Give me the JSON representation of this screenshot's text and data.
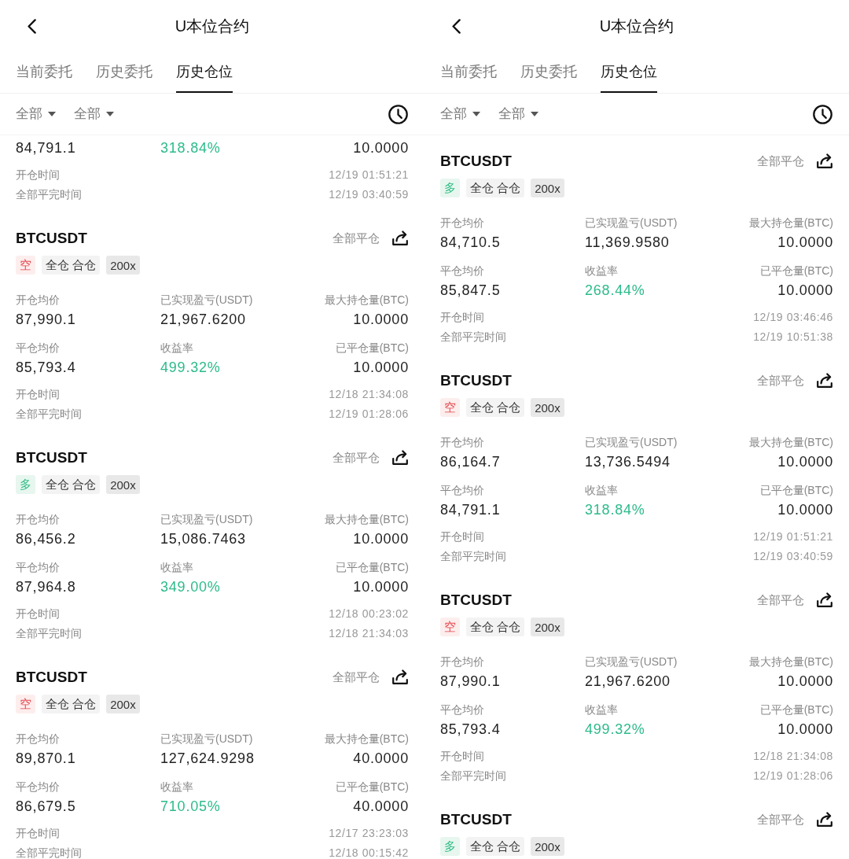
{
  "screens": [
    {
      "title": "U本位合约",
      "tabs": [
        {
          "label": "当前委托",
          "selected": false
        },
        {
          "label": "历史委托",
          "selected": false
        },
        {
          "label": "历史仓位",
          "selected": true
        }
      ],
      "filters": [
        {
          "label": "全部"
        },
        {
          "label": "全部"
        }
      ],
      "positions": [
        {
          "metrics": [
            {
              "kind": "plain",
              "value": "84,791.1"
            },
            {
              "kind": "gain",
              "value": "318.84%"
            },
            {
              "kind": "plain",
              "value": "10.0000"
            }
          ],
          "times": [
            {
              "label": "开仓时间",
              "value": "12/19 01:51:21"
            },
            {
              "label": "全部平完时间",
              "value": "12/19 03:40:59"
            }
          ]
        },
        {
          "symbol": "BTCUSDT",
          "close_label": "全部平仓",
          "tags": [
            {
              "kind": "short",
              "text": "空"
            },
            {
              "kind": "mode",
              "text": "全仓 合仓"
            },
            {
              "kind": "leverage",
              "text": "200x"
            }
          ],
          "metrics": [
            {
              "kind": "plain",
              "label": "开仓均价",
              "value": "87,990.1"
            },
            {
              "kind": "plain",
              "label": "已实现盈亏(USDT)",
              "value": "21,967.6200"
            },
            {
              "kind": "plain",
              "label": "最大持仓量(BTC)",
              "value": "10.0000"
            },
            {
              "kind": "plain",
              "label": "平仓均价",
              "value": "85,793.4"
            },
            {
              "kind": "gain",
              "label": "收益率",
              "value": "499.32%"
            },
            {
              "kind": "plain",
              "label": "已平仓量(BTC)",
              "value": "10.0000"
            }
          ],
          "times": [
            {
              "label": "开仓时间",
              "value": "12/18 21:34:08"
            },
            {
              "label": "全部平完时间",
              "value": "12/19 01:28:06"
            }
          ]
        },
        {
          "symbol": "BTCUSDT",
          "close_label": "全部平仓",
          "tags": [
            {
              "kind": "long",
              "text": "多"
            },
            {
              "kind": "mode",
              "text": "全仓 合仓"
            },
            {
              "kind": "leverage",
              "text": "200x"
            }
          ],
          "metrics": [
            {
              "kind": "plain",
              "label": "开仓均价",
              "value": "86,456.2"
            },
            {
              "kind": "plain",
              "label": "已实现盈亏(USDT)",
              "value": "15,086.7463"
            },
            {
              "kind": "plain",
              "label": "最大持仓量(BTC)",
              "value": "10.0000"
            },
            {
              "kind": "plain",
              "label": "平仓均价",
              "value": "87,964.8"
            },
            {
              "kind": "gain",
              "label": "收益率",
              "value": "349.00%"
            },
            {
              "kind": "plain",
              "label": "已平仓量(BTC)",
              "value": "10.0000"
            }
          ],
          "times": [
            {
              "label": "开仓时间",
              "value": "12/18 00:23:02"
            },
            {
              "label": "全部平完时间",
              "value": "12/18 21:34:03"
            }
          ]
        },
        {
          "symbol": "BTCUSDT",
          "close_label": "全部平仓",
          "tags": [
            {
              "kind": "short",
              "text": "空"
            },
            {
              "kind": "mode",
              "text": "全仓 合仓"
            },
            {
              "kind": "leverage",
              "text": "200x"
            }
          ],
          "metrics": [
            {
              "kind": "plain",
              "label": "开仓均价",
              "value": "89,870.1"
            },
            {
              "kind": "plain",
              "label": "已实现盈亏(USDT)",
              "value": "127,624.9298"
            },
            {
              "kind": "plain",
              "label": "最大持仓量(BTC)",
              "value": "40.0000"
            },
            {
              "kind": "plain",
              "label": "平仓均价",
              "value": "86,679.5"
            },
            {
              "kind": "gain",
              "label": "收益率",
              "value": "710.05%"
            },
            {
              "kind": "plain",
              "label": "已平仓量(BTC)",
              "value": "40.0000"
            }
          ],
          "times": [
            {
              "label": "开仓时间",
              "value": "12/17 23:23:03"
            },
            {
              "label": "全部平完时间",
              "value": "12/18 00:15:42"
            }
          ]
        }
      ]
    },
    {
      "title": "U本位合约",
      "tabs": [
        {
          "label": "当前委托",
          "selected": false
        },
        {
          "label": "历史委托",
          "selected": false
        },
        {
          "label": "历史仓位",
          "selected": true
        }
      ],
      "filters": [
        {
          "label": "全部"
        },
        {
          "label": "全部"
        }
      ],
      "positions": [
        {
          "symbol": "BTCUSDT",
          "close_label": "全部平仓",
          "tags": [
            {
              "kind": "long",
              "text": "多"
            },
            {
              "kind": "mode",
              "text": "全仓 合仓"
            },
            {
              "kind": "leverage",
              "text": "200x"
            }
          ],
          "metrics": [
            {
              "kind": "plain",
              "label": "开仓均价",
              "value": "84,710.5"
            },
            {
              "kind": "plain",
              "label": "已实现盈亏(USDT)",
              "value": "11,369.9580"
            },
            {
              "kind": "plain",
              "label": "最大持仓量(BTC)",
              "value": "10.0000"
            },
            {
              "kind": "plain",
              "label": "平仓均价",
              "value": "85,847.5"
            },
            {
              "kind": "gain",
              "label": "收益率",
              "value": "268.44%"
            },
            {
              "kind": "plain",
              "label": "已平仓量(BTC)",
              "value": "10.0000"
            }
          ],
          "times": [
            {
              "label": "开仓时间",
              "value": "12/19 03:46:46"
            },
            {
              "label": "全部平完时间",
              "value": "12/19 10:51:38"
            }
          ]
        },
        {
          "symbol": "BTCUSDT",
          "close_label": "全部平仓",
          "tags": [
            {
              "kind": "short",
              "text": "空"
            },
            {
              "kind": "mode",
              "text": "全仓 合仓"
            },
            {
              "kind": "leverage",
              "text": "200x"
            }
          ],
          "metrics": [
            {
              "kind": "plain",
              "label": "开仓均价",
              "value": "86,164.7"
            },
            {
              "kind": "plain",
              "label": "已实现盈亏(USDT)",
              "value": "13,736.5494"
            },
            {
              "kind": "plain",
              "label": "最大持仓量(BTC)",
              "value": "10.0000"
            },
            {
              "kind": "plain",
              "label": "平仓均价",
              "value": "84,791.1"
            },
            {
              "kind": "gain",
              "label": "收益率",
              "value": "318.84%"
            },
            {
              "kind": "plain",
              "label": "已平仓量(BTC)",
              "value": "10.0000"
            }
          ],
          "times": [
            {
              "label": "开仓时间",
              "value": "12/19 01:51:21"
            },
            {
              "label": "全部平完时间",
              "value": "12/19 03:40:59"
            }
          ]
        },
        {
          "symbol": "BTCUSDT",
          "close_label": "全部平仓",
          "tags": [
            {
              "kind": "short",
              "text": "空"
            },
            {
              "kind": "mode",
              "text": "全仓 合仓"
            },
            {
              "kind": "leverage",
              "text": "200x"
            }
          ],
          "metrics": [
            {
              "kind": "plain",
              "label": "开仓均价",
              "value": "87,990.1"
            },
            {
              "kind": "plain",
              "label": "已实现盈亏(USDT)",
              "value": "21,967.6200"
            },
            {
              "kind": "plain",
              "label": "最大持仓量(BTC)",
              "value": "10.0000"
            },
            {
              "kind": "plain",
              "label": "平仓均价",
              "value": "85,793.4"
            },
            {
              "kind": "gain",
              "label": "收益率",
              "value": "499.32%"
            },
            {
              "kind": "plain",
              "label": "已平仓量(BTC)",
              "value": "10.0000"
            }
          ],
          "times": [
            {
              "label": "开仓时间",
              "value": "12/18 21:34:08"
            },
            {
              "label": "全部平完时间",
              "value": "12/19 01:28:06"
            }
          ]
        },
        {
          "symbol": "BTCUSDT",
          "close_label": "全部平仓",
          "tags": [
            {
              "kind": "long",
              "text": "多"
            },
            {
              "kind": "mode",
              "text": "全仓 合仓"
            },
            {
              "kind": "leverage",
              "text": "200x"
            }
          ]
        }
      ]
    }
  ]
}
